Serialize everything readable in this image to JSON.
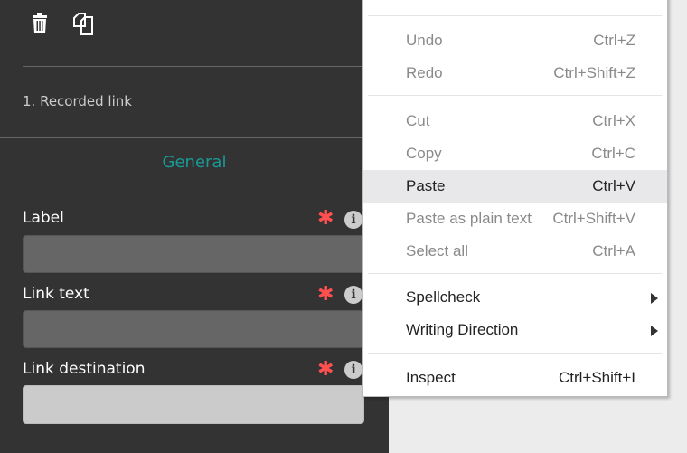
{
  "panel": {
    "icons": [
      "trash-icon",
      "copy-icon"
    ],
    "step_title": "1. Recorded link",
    "section_title": "General",
    "accent_color": "#1a9a96",
    "fields": [
      {
        "label": "Label",
        "value": ""
      },
      {
        "label": "Link text",
        "value": ""
      },
      {
        "label": "Link destination",
        "value": ""
      }
    ]
  },
  "context_menu": {
    "items": [
      {
        "label": "Undo",
        "shortcut": "Ctrl+Z",
        "enabled": false
      },
      {
        "label": "Redo",
        "shortcut": "Ctrl+Shift+Z",
        "enabled": false
      },
      {
        "label": "Cut",
        "shortcut": "Ctrl+X",
        "enabled": false
      },
      {
        "label": "Copy",
        "shortcut": "Ctrl+C",
        "enabled": false
      },
      {
        "label": "Paste",
        "shortcut": "Ctrl+V",
        "enabled": true,
        "highlighted": true
      },
      {
        "label": "Paste as plain text",
        "shortcut": "Ctrl+Shift+V",
        "enabled": false
      },
      {
        "label": "Select all",
        "shortcut": "Ctrl+A",
        "enabled": false
      },
      {
        "label": "Spellcheck",
        "submenu": true,
        "enabled": true
      },
      {
        "label": "Writing Direction",
        "submenu": true,
        "enabled": true
      },
      {
        "label": "Inspect",
        "shortcut": "Ctrl+Shift+I",
        "enabled": true
      }
    ]
  }
}
